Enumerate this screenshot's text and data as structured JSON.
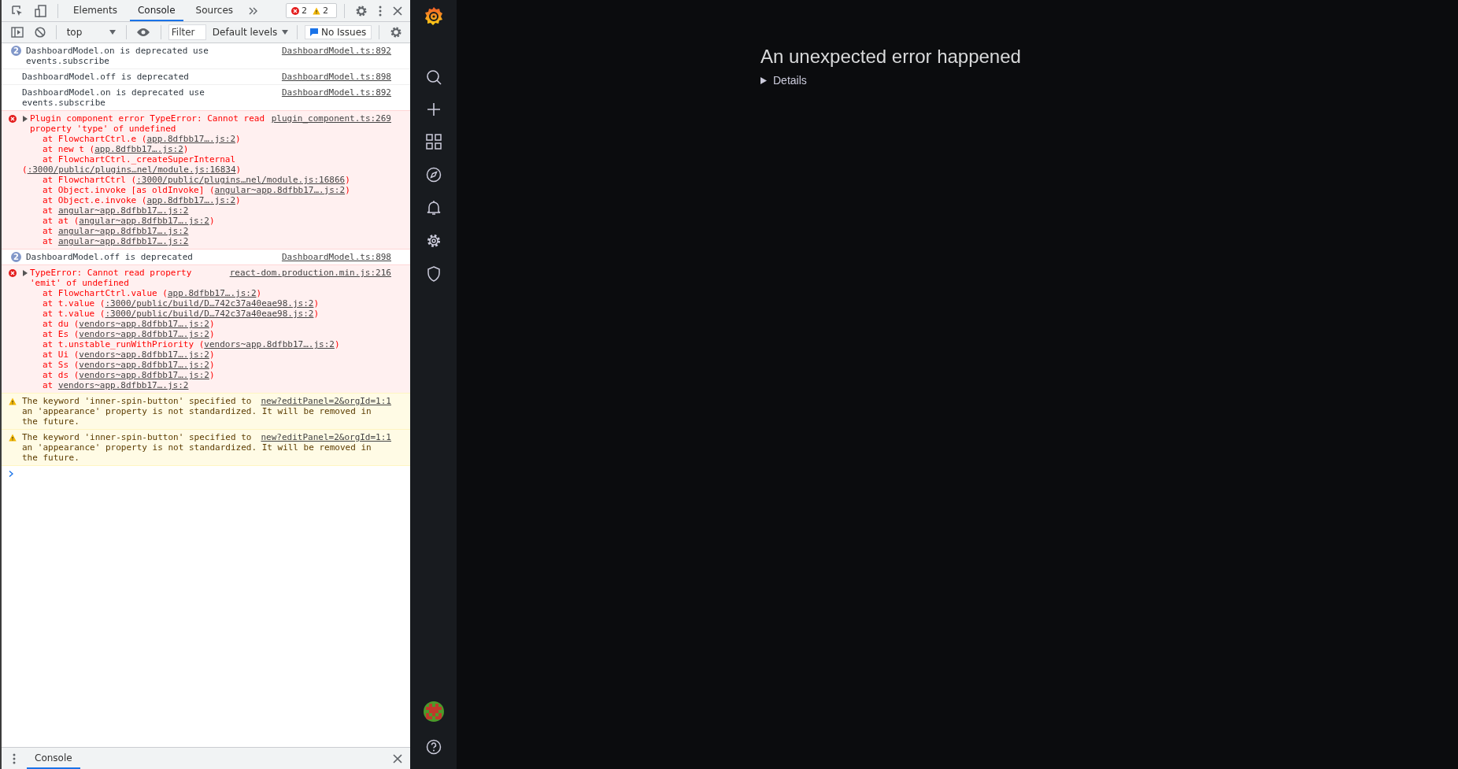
{
  "devtools": {
    "tabs": [
      {
        "label": "Elements",
        "selected": false
      },
      {
        "label": "Console",
        "selected": true
      },
      {
        "label": "Sources",
        "selected": false
      }
    ],
    "error_count": "2",
    "warning_count": "2",
    "context": "top",
    "filter": {
      "placeholder": "Filter"
    },
    "levels": "Default levels",
    "issues": "No Issues",
    "messages": [
      {
        "kind": "info",
        "count": "2",
        "text": "DashboardModel.on is deprecated use events.subscribe",
        "source": "DashboardModel.ts:892"
      },
      {
        "kind": "info",
        "text": "DashboardModel.off is deprecated",
        "source": "DashboardModel.ts:898"
      },
      {
        "kind": "info",
        "text": "DashboardModel.on is deprecated use events.subscribe",
        "source": "DashboardModel.ts:892"
      },
      {
        "kind": "error",
        "expanded": false,
        "text": "Plugin component error TypeError: Cannot read property 'type' of undefined",
        "source": "plugin_component.ts:269",
        "stack": [
          {
            "prefix": "at FlowchartCtrl.e (",
            "link": "app.8dfbb17….js:2",
            "suffix": ")"
          },
          {
            "prefix": "at new t (",
            "link": "app.8dfbb17….js:2",
            "suffix": ")"
          },
          {
            "prefix": "at FlowchartCtrl._createSuperInternal (",
            "link": ":3000/public/plugins…nel/module.js:16834",
            "suffix": ")"
          },
          {
            "prefix": "at FlowchartCtrl (",
            "link": ":3000/public/plugins…nel/module.js:16866",
            "suffix": ")"
          },
          {
            "prefix": "at Object.invoke [as oldInvoke] (",
            "link": "angular~app.8dfbb17….js:2",
            "suffix": ")"
          },
          {
            "prefix": "at Object.e.invoke (",
            "link": "app.8dfbb17….js:2",
            "suffix": ")"
          },
          {
            "prefix": "at ",
            "link": "angular~app.8dfbb17….js:2"
          },
          {
            "prefix": "at at (",
            "link": "angular~app.8dfbb17….js:2",
            "suffix": ")"
          },
          {
            "prefix": "at ",
            "link": "angular~app.8dfbb17….js:2"
          },
          {
            "prefix": "at ",
            "link": "angular~app.8dfbb17….js:2"
          }
        ]
      },
      {
        "kind": "info",
        "count": "2",
        "text": "DashboardModel.off is deprecated",
        "source": "DashboardModel.ts:898"
      },
      {
        "kind": "error",
        "expanded": false,
        "text": "TypeError: Cannot read property 'emit' of undefined",
        "source": "react-dom.production.min.js:216",
        "stack": [
          {
            "prefix": "at FlowchartCtrl.value (",
            "link": "app.8dfbb17….js:2",
            "suffix": ")"
          },
          {
            "prefix": "at t.value (",
            "link": ":3000/public/build/D…742c37a40eae98.js:2",
            "suffix": ")"
          },
          {
            "prefix": "at t.value (",
            "link": ":3000/public/build/D…742c37a40eae98.js:2",
            "suffix": ")"
          },
          {
            "prefix": "at du (",
            "link": "vendors~app.8dfbb17….js:2",
            "suffix": ")"
          },
          {
            "prefix": "at Es (",
            "link": "vendors~app.8dfbb17….js:2",
            "suffix": ")"
          },
          {
            "prefix": "at t.unstable_runWithPriority (",
            "link": "vendors~app.8dfbb17….js:2",
            "suffix": ")"
          },
          {
            "prefix": "at Ui (",
            "link": "vendors~app.8dfbb17….js:2",
            "suffix": ")"
          },
          {
            "prefix": "at Ss (",
            "link": "vendors~app.8dfbb17….js:2",
            "suffix": ")"
          },
          {
            "prefix": "at ds (",
            "link": "vendors~app.8dfbb17….js:2",
            "suffix": ")"
          },
          {
            "prefix": "at ",
            "link": "vendors~app.8dfbb17….js:2"
          }
        ]
      },
      {
        "kind": "warning",
        "text": "The keyword 'inner-spin-button' specified to an 'appearance' property is not standardized. It will be removed in the future.",
        "source": "new?editPanel=2&orgId=1:1"
      },
      {
        "kind": "warning",
        "text": "The keyword 'inner-spin-button' specified to an 'appearance' property is not standardized. It will be removed in the future.",
        "source": "new?editPanel=2&orgId=1:1"
      }
    ],
    "drawer_tabs": [
      {
        "label": "Console",
        "selected": true
      }
    ]
  },
  "grafana": {
    "error": {
      "title": "An unexpected error happened",
      "details": "Details",
      "expanded": false
    }
  }
}
